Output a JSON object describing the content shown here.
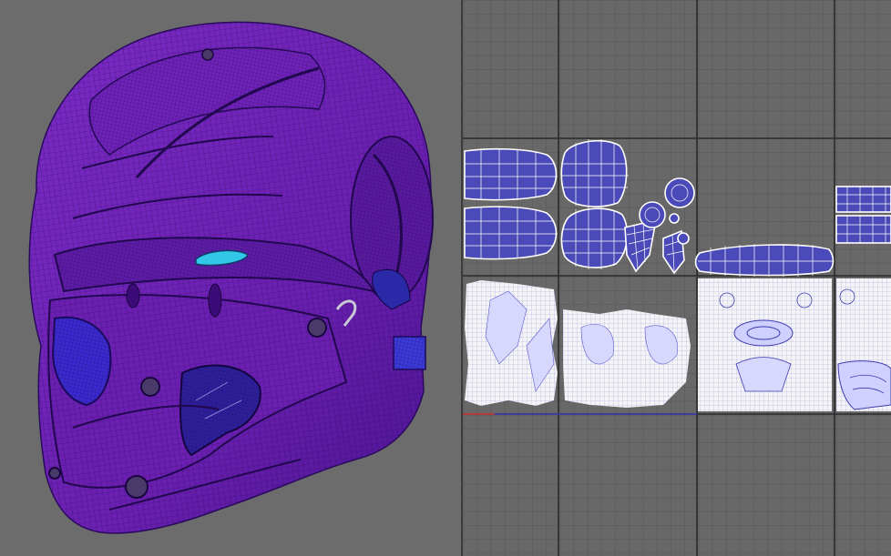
{
  "viewport": {
    "object": "helmet-mesh",
    "colors": {
      "mesh": "#6a1fb0",
      "mesh_dark": "#3b0b78",
      "wire": "#2a0a5e",
      "visor_glow": "#32c7e8",
      "background": "#6c6c6c"
    }
  },
  "uv_editor": {
    "colors": {
      "background": "#686868",
      "grid": "#5e5e5e",
      "udim_lines": "#2b2b2b",
      "shell_fill": "#4a4ab8",
      "shell_edge": "#ffffff"
    },
    "tiles_with_dense_uvs": 4,
    "tiles_with_simple_shells": 4
  }
}
